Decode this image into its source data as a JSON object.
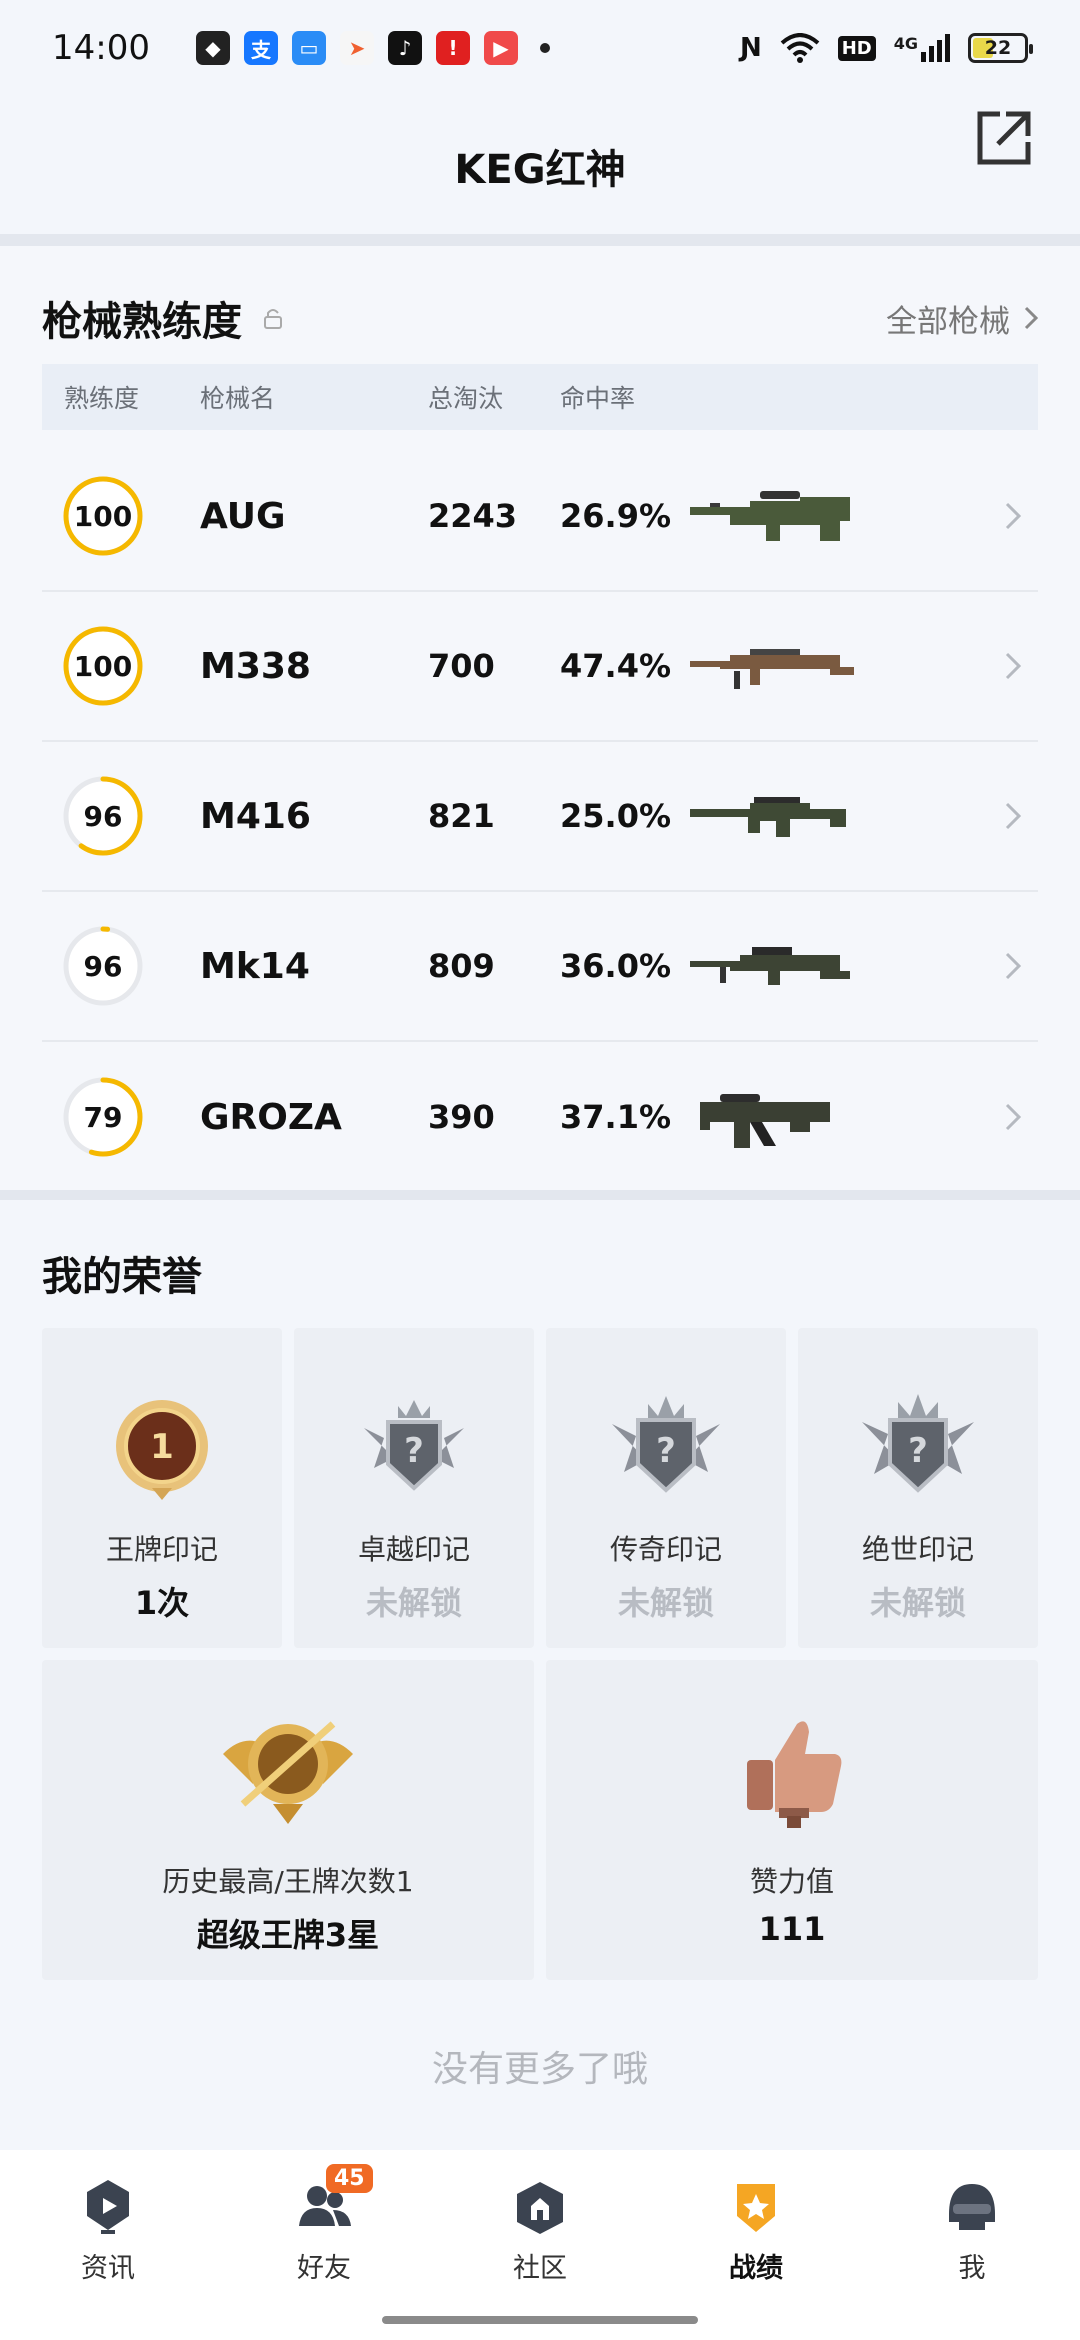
{
  "status_bar": {
    "time": "14:00",
    "network": "4G",
    "hd": "HD",
    "battery": "22"
  },
  "header": {
    "title": "KEG红神"
  },
  "weapons": {
    "title": "枪械熟练度",
    "all_link": "全部枪械",
    "columns": [
      "熟练度",
      "枪械名",
      "总淘汰",
      "命中率"
    ],
    "rows": [
      {
        "proficiency": "100",
        "progress": 1.0,
        "name": "AUG",
        "kills": "2243",
        "hit_rate": "26.9%"
      },
      {
        "proficiency": "100",
        "progress": 1.0,
        "name": "M338",
        "kills": "700",
        "hit_rate": "47.4%"
      },
      {
        "proficiency": "96",
        "progress": 0.6,
        "name": "M416",
        "kills": "821",
        "hit_rate": "25.0%"
      },
      {
        "proficiency": "96",
        "progress": 0.02,
        "name": "Mk14",
        "kills": "809",
        "hit_rate": "36.0%"
      },
      {
        "proficiency": "79",
        "progress": 0.55,
        "name": "GROZA",
        "kills": "390",
        "hit_rate": "37.1%"
      }
    ]
  },
  "honors": {
    "title": "我的荣誉",
    "marks": [
      {
        "label": "王牌印记",
        "value": "1次",
        "locked": false
      },
      {
        "label": "卓越印记",
        "value": "未解锁",
        "locked": true
      },
      {
        "label": "传奇印记",
        "value": "未解锁",
        "locked": true
      },
      {
        "label": "绝世印记",
        "value": "未解锁",
        "locked": true
      }
    ],
    "highest": {
      "label": "历史最高/王牌次数1",
      "value": "超级王牌3星"
    },
    "likes": {
      "label": "赞力值",
      "value": "111"
    },
    "no_more": "没有更多了哦"
  },
  "nav": {
    "items": [
      {
        "label": "资讯"
      },
      {
        "label": "好友",
        "badge": "45"
      },
      {
        "label": "社区"
      },
      {
        "label": "战绩"
      },
      {
        "label": "我"
      }
    ]
  },
  "colors": {
    "accent": "#f5b800",
    "ring_track": "#e6e8ec",
    "nav_active": "#f5a623"
  }
}
